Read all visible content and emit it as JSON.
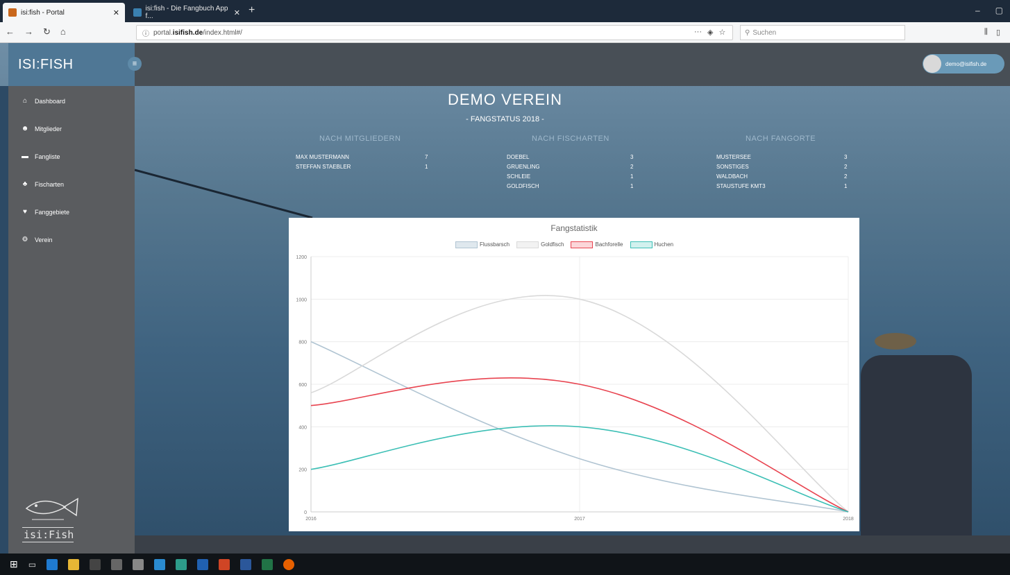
{
  "browser": {
    "tabs": [
      {
        "label": "isi:fish - Portal",
        "active": true
      },
      {
        "label": "isi:fish - Die Fangbuch App f...",
        "active": false
      }
    ],
    "url_prefix": "portal.",
    "url_domain": "isifish.de",
    "url_path": "/index.html#/",
    "search_placeholder": "Suchen"
  },
  "app": {
    "brand": "ISI:FISH",
    "user_email": "demo@isifish.de",
    "sidebar": [
      {
        "label": "Dashboard",
        "icon": "home-icon"
      },
      {
        "label": "Mitglieder",
        "icon": "users-icon"
      },
      {
        "label": "Fangliste",
        "icon": "list-icon"
      },
      {
        "label": "Fischarten",
        "icon": "fish-species-icon"
      },
      {
        "label": "Fanggebiete",
        "icon": "map-marker-icon"
      },
      {
        "label": "Verein",
        "icon": "gears-icon"
      }
    ],
    "logo_text": "isi:Fish",
    "title": "DEMO VEREIN",
    "subtitle": "- FANGSTATUS 2018 -",
    "columns": [
      {
        "heading": "NACH MITGLIEDERN",
        "rows": [
          [
            "MAX MUSTERMANN",
            "7"
          ],
          [
            "STEFFAN STAEBLER",
            "1"
          ]
        ]
      },
      {
        "heading": "NACH FISCHARTEN",
        "rows": [
          [
            "DOEBEL",
            "3"
          ],
          [
            "GRUENLING",
            "2"
          ],
          [
            "SCHLEIE",
            "1"
          ],
          [
            "GOLDFISCH",
            "1"
          ]
        ]
      },
      {
        "heading": "NACH FANGORTE",
        "rows": [
          [
            "MUSTERSEE",
            "3"
          ],
          [
            "SONSTIGES",
            "2"
          ],
          [
            "WALDBACH",
            "2"
          ],
          [
            "STAUSTUFE KMT3",
            "1"
          ]
        ]
      }
    ]
  },
  "chart_data": {
    "type": "line",
    "title": "Fangstatistik",
    "x": [
      "2016",
      "2017",
      "2018"
    ],
    "ylim": [
      0,
      1200
    ],
    "yticks": [
      0,
      200,
      400,
      600,
      800,
      1000,
      1200
    ],
    "series": [
      {
        "name": "Flussbarsch",
        "color": "#b0c4d2",
        "values": [
          800,
          250,
          0
        ]
      },
      {
        "name": "Goldfisch",
        "color": "#d9d9d9",
        "values": [
          560,
          1000,
          0
        ]
      },
      {
        "name": "Bachforelle",
        "color": "#e8434f",
        "values": [
          500,
          600,
          0
        ]
      },
      {
        "name": "Huchen",
        "color": "#3cbfb5",
        "values": [
          200,
          400,
          0
        ]
      }
    ]
  }
}
